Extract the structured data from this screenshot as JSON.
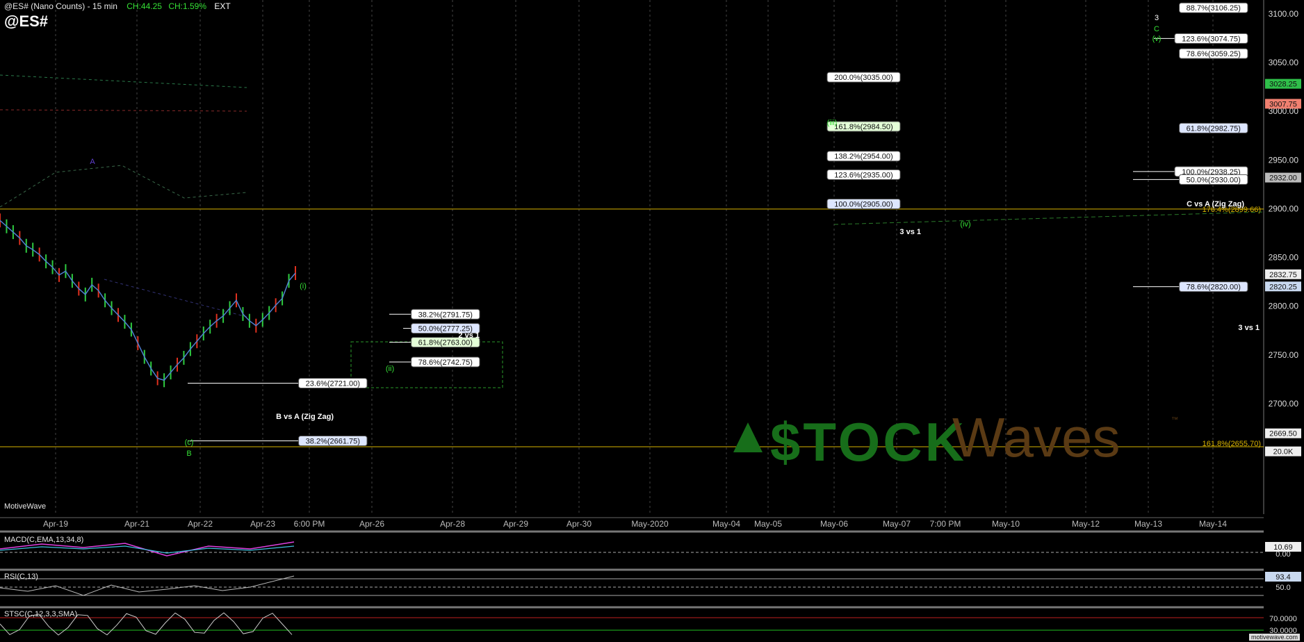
{
  "header": {
    "title": "@ES# (Nano Counts) - 15 min",
    "change": "CH:44.25",
    "change_pct": "CH:1.59%",
    "session": "EXT",
    "symbol": "@ES#"
  },
  "source_label": "MotiveWave",
  "watermark_url": "motivewave.com",
  "logo": {
    "text_left": "$TOCK",
    "text_right": "Waves",
    "tm": "™"
  },
  "colors": {
    "up": "#2ecc40",
    "down": "#e0301e",
    "fib_line": "#ffffff",
    "gold": "#d9b400",
    "ema": "#4f7fd0"
  },
  "chart_data": {
    "type": "line",
    "title": "@ES# (Nano Counts) - 15 min",
    "ylim": [
      2640,
      3125
    ],
    "price_ticks": [
      3100,
      3050,
      3000,
      2950,
      2900,
      2850,
      2800,
      2750,
      2700
    ],
    "x_ticks": [
      "Apr-19",
      "Apr-21",
      "Apr-22",
      "Apr-23",
      "6:00 PM",
      "Apr-26",
      "Apr-28",
      "Apr-29",
      "Apr-30",
      "May-2020",
      "May-04",
      "May-05",
      "May-06",
      "May-07",
      "7:00 PM",
      "May-10",
      "May-12",
      "May-13",
      "May-14"
    ],
    "price_series": [
      2888,
      2882,
      2876,
      2870,
      2862,
      2858,
      2853,
      2846,
      2840,
      2832,
      2836,
      2826,
      2818,
      2812,
      2822,
      2816,
      2806,
      2798,
      2791,
      2784,
      2776,
      2762,
      2748,
      2736,
      2726,
      2724,
      2732,
      2740,
      2747,
      2756,
      2764,
      2772,
      2779,
      2785,
      2790,
      2798,
      2806,
      2792,
      2785,
      2780,
      2786,
      2793,
      2801,
      2808,
      2826,
      2834
    ],
    "fib_levels": [
      {
        "label": "88.7%(3106.25)",
        "value": 3106.25
      },
      {
        "label": "123.6%(3074.75)",
        "value": 3074.75
      },
      {
        "label": "78.6%(3059.25)",
        "value": 3059.25
      },
      {
        "label": "200.0%(3035.00)",
        "value": 3035.0
      },
      {
        "label": "161.8%(2984.50)",
        "value": 2984.5
      },
      {
        "label": "61.8%(2982.75)",
        "value": 2982.75
      },
      {
        "label": "138.2%(2954.00)",
        "value": 2954.0
      },
      {
        "label": "100.0%(2938.25)",
        "value": 2938.25
      },
      {
        "label": "123.6%(2935.00)",
        "value": 2935.0
      },
      {
        "label": "50.0%(2930.00)",
        "value": 2930.0
      },
      {
        "label": "100.0%(2905.00)",
        "value": 2905.0
      },
      {
        "label": "78.6%(2820.00)",
        "value": 2820.0
      },
      {
        "label": "38.2%(2791.75)",
        "value": 2791.75
      },
      {
        "label": "50.0%(2777.25)",
        "value": 2777.25
      },
      {
        "label": "61.8%(2763.00)",
        "value": 2763.0
      },
      {
        "label": "78.6%(2742.75)",
        "value": 2742.75
      },
      {
        "label": "23.6%(2721.00)",
        "value": 2721.0
      },
      {
        "label": "38.2%(2661.75)",
        "value": 2661.75
      }
    ],
    "gold_levels": [
      {
        "label": "176.4%(2899.66)",
        "value": 2899.66
      },
      {
        "label": "161.8%(2655.70)",
        "value": 2655.7
      }
    ],
    "annotations": [
      "2 vs 1",
      "3 vs 1",
      "3 vs 1",
      "B vs A (Zig Zag)",
      "C vs A (Zig Zag)"
    ],
    "wave_labels": [
      "(i)",
      "(ii)",
      "(iii)",
      "(iv)",
      "(c)",
      "B",
      "3",
      "C",
      "(v)",
      "A"
    ],
    "price_badges": [
      {
        "label": "3028.25",
        "value": 3028.25,
        "bg": "#2fbf4a"
      },
      {
        "label": "3007.75",
        "value": 3007.75,
        "bg": "#f08070"
      },
      {
        "label": "2932.00",
        "value": 2932.0,
        "bg": "#bbbbbb"
      },
      {
        "label": "2832.75",
        "value": 2832.75,
        "bg": "#eeeeee"
      },
      {
        "label": "2820.25",
        "value": 2820.25,
        "bg": "#c9d9f0"
      },
      {
        "label": "2669.50",
        "value": 2669.5,
        "bg": "#eeeeee"
      },
      {
        "label": "20.0K",
        "value": 2651.0,
        "bg": "#eeeeee"
      }
    ],
    "indicators": {
      "macd": {
        "label": "MACD(C,EMA,13,34,8)",
        "values": [
          "10.69",
          "0.00"
        ]
      },
      "rsi": {
        "label": "RSI(C,13)",
        "values": [
          "93.4",
          "50.0"
        ]
      },
      "stoch": {
        "label": "STSC(C,12,3,3,SMA)",
        "values": [
          "70.0000",
          "30.0000"
        ]
      }
    }
  }
}
